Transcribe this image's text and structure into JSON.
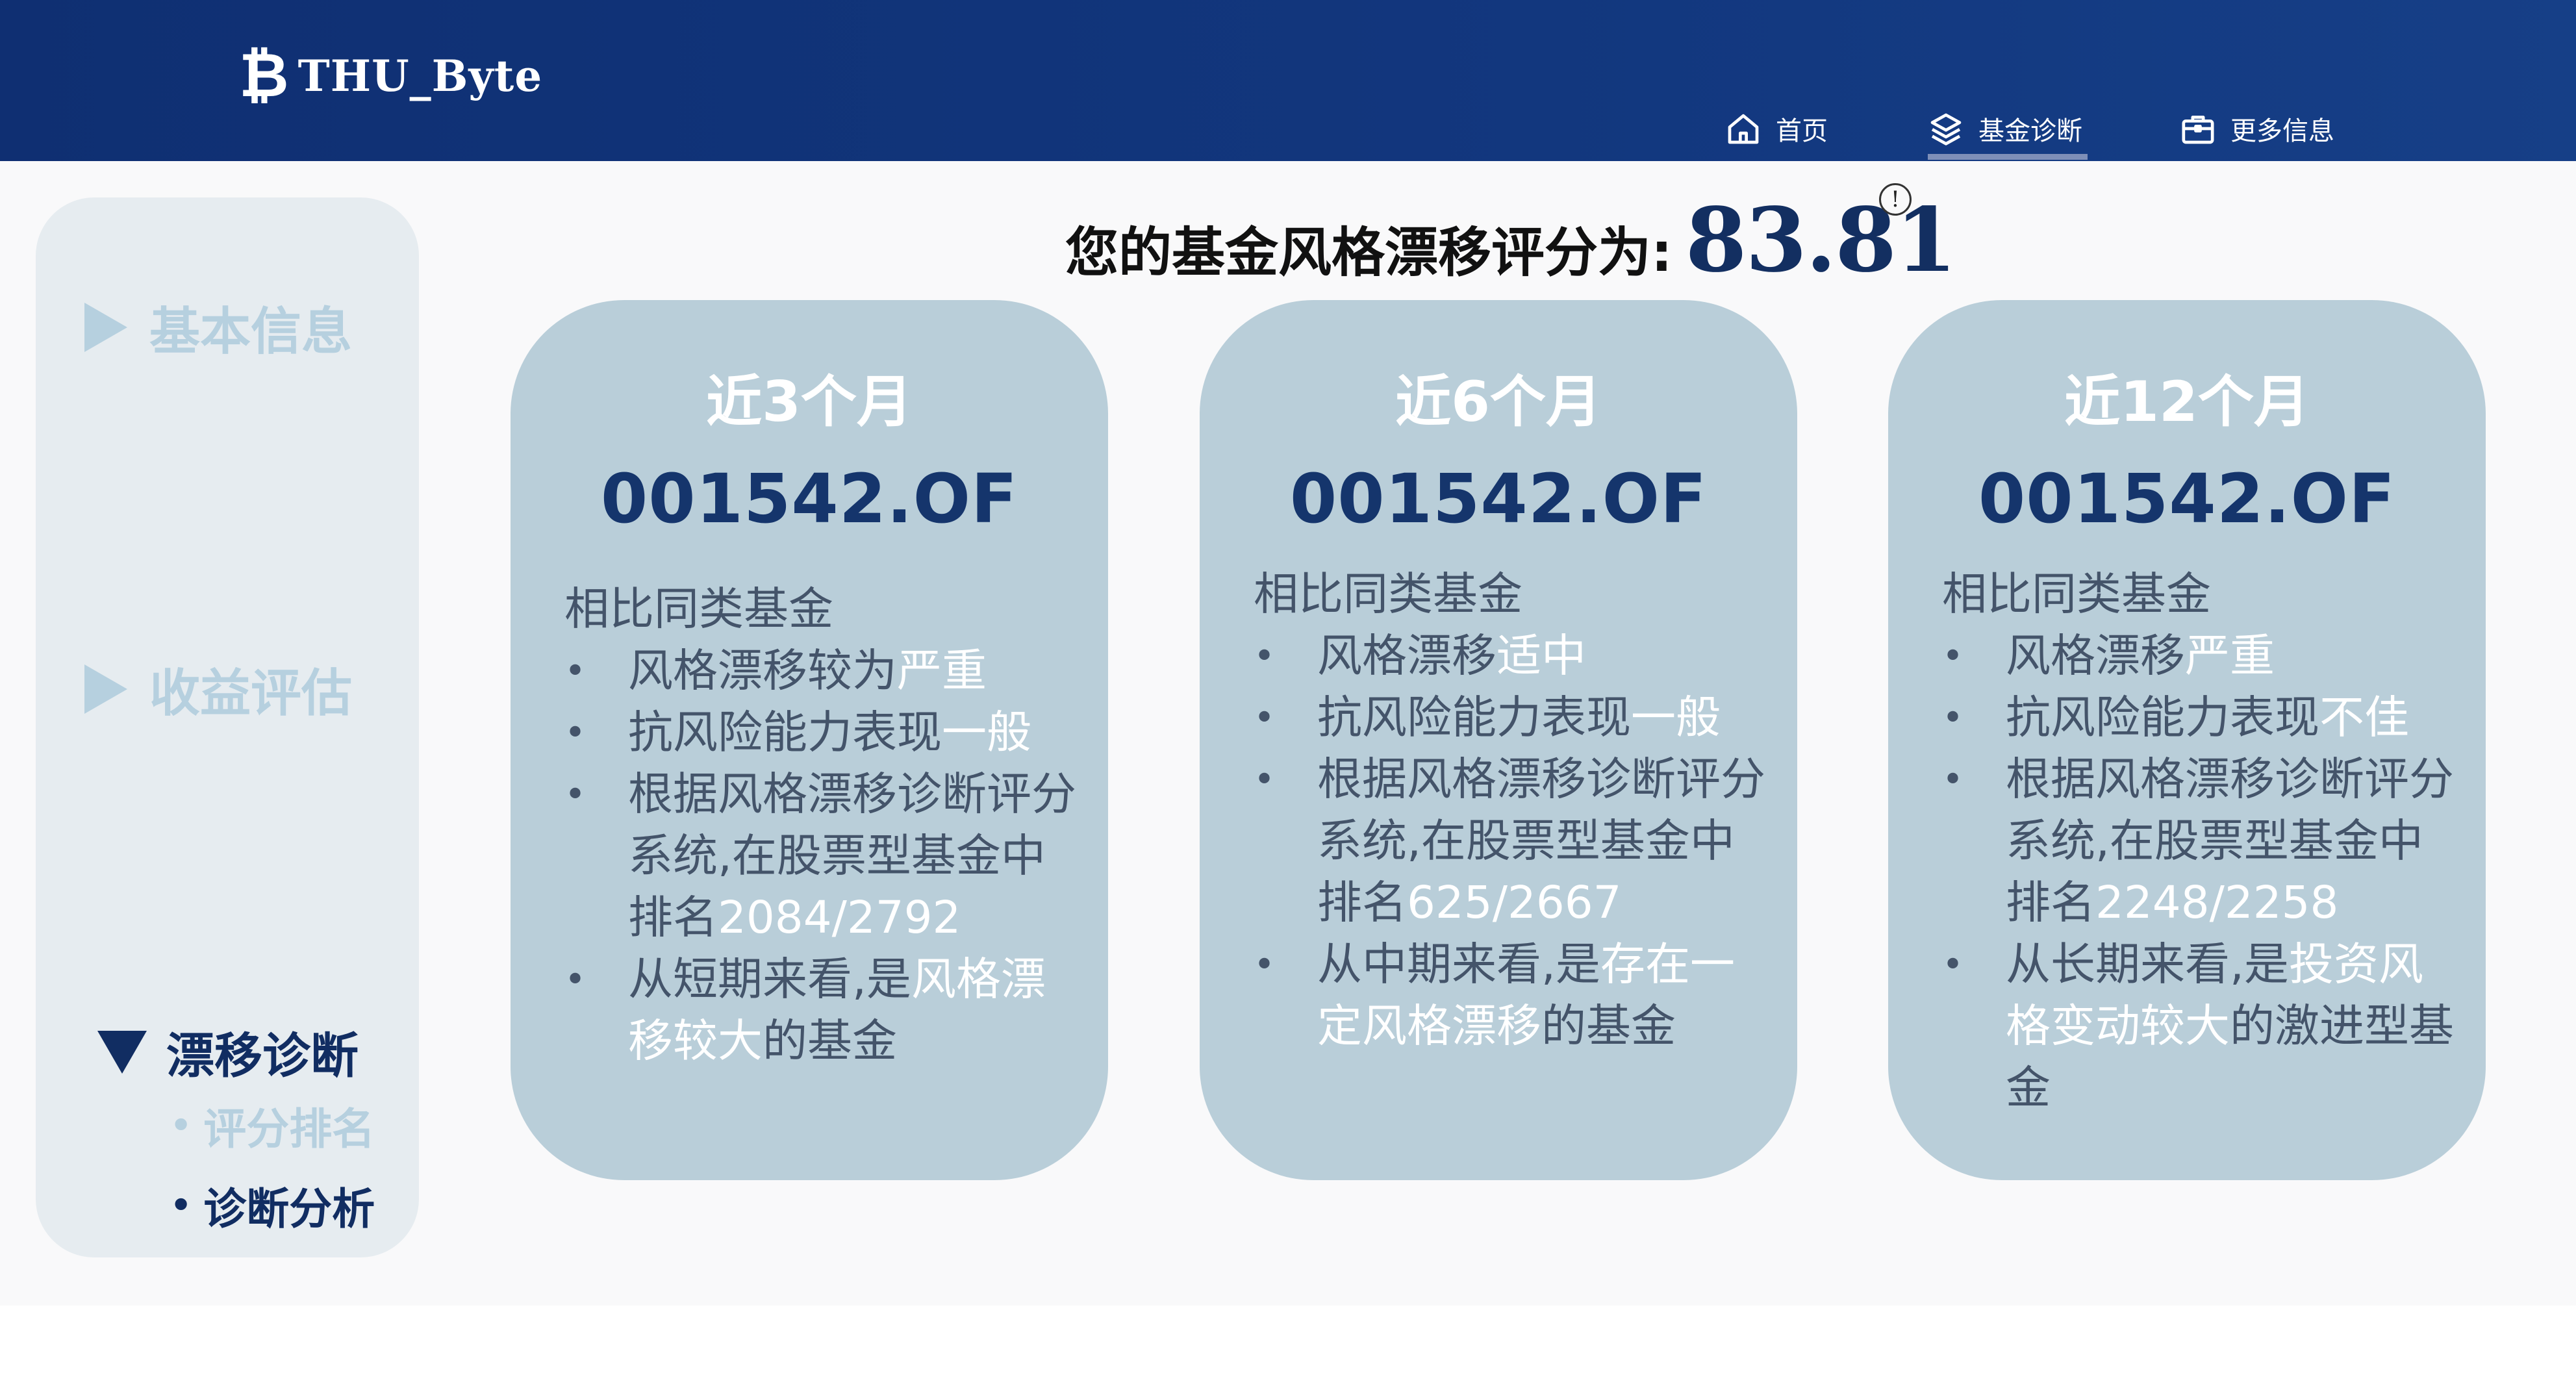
{
  "brand": {
    "logo_mark": "₿",
    "name": "THU_Byte"
  },
  "nav": [
    {
      "label": "首页",
      "icon": "home-icon"
    },
    {
      "label": "基金诊断",
      "icon": "layers-icon",
      "active": true
    },
    {
      "label": "更多信息",
      "icon": "briefcase-icon"
    }
  ],
  "sidebar": {
    "basic": "基本信息",
    "returns": "收益评估",
    "drift": "漂移诊断",
    "sub_rank": "评分排名",
    "sub_analysis": "诊断分析",
    "bullet": "•"
  },
  "score": {
    "label": "您的基金风格漂移评分为:",
    "value": "83.81",
    "info_glyph": "!"
  },
  "cards": [
    {
      "period": "近3个月",
      "code": "001542.OF",
      "intro": "相比同类基金",
      "items": [
        [
          "风格漂移较为",
          "严重"
        ],
        [
          "抗风险能力表现",
          "一般"
        ],
        [
          "根据风格漂移诊断评分系统,在股票型基金中排名",
          "2084/2792"
        ],
        [
          "从短期来看,是",
          "风格漂移较大",
          "的基金"
        ]
      ]
    },
    {
      "period": "近6个月",
      "code": "001542.OF",
      "intro": "相比同类基金",
      "items": [
        [
          "风格漂移",
          "适中"
        ],
        [
          "抗风险能力表现",
          "一般"
        ],
        [
          "根据风格漂移诊断评分系统,在股票型基金中排名",
          "625/2667"
        ],
        [
          "从中期来看,是",
          "存在一定风格漂移",
          "的基金"
        ]
      ]
    },
    {
      "period": "近12个月",
      "code": "001542.OF",
      "intro": "相比同类基金",
      "items": [
        [
          "风格漂移",
          "严重"
        ],
        [
          "抗风险能力表现",
          "不佳"
        ],
        [
          "根据风格漂移诊断评分系统,在股票型基金中排名",
          "2248/2258"
        ],
        [
          "从长期来看,是",
          "投资风格变动较大",
          "的激进型基金"
        ]
      ]
    }
  ],
  "colors": {
    "header": "#0f2f72",
    "card": "#b9ced9",
    "code": "#15356c",
    "body_text": "#44546a",
    "highlight": "#ffffff",
    "sidebar_bg": "#e6ecf0",
    "sidebar_active": "#112d62",
    "sidebar_inactive": "#b6d0df"
  }
}
